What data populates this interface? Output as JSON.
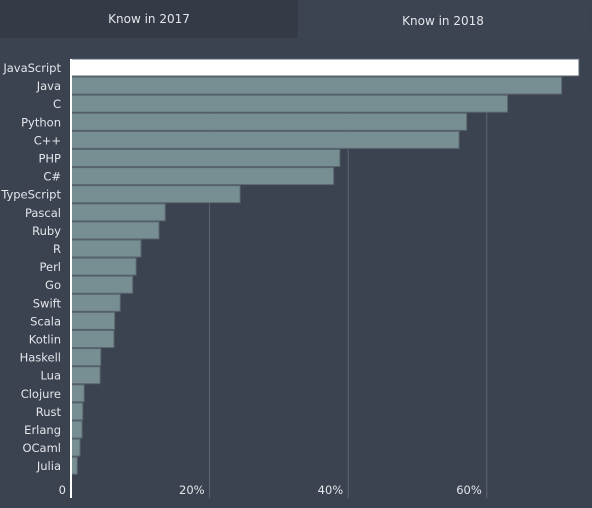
{
  "tabs": [
    {
      "label": "Know in 2017",
      "active": false
    },
    {
      "label": "Know in 2018",
      "active": true
    }
  ],
  "colors": {
    "bar": "#778f92",
    "bar_highlight": "#ffffff",
    "bar_stroke": "#5a6670",
    "gridline": "#5e6674",
    "axis": "#ffffff"
  },
  "chart_data": {
    "type": "bar",
    "orientation": "horizontal",
    "title": "",
    "xlabel": "",
    "ylabel": "",
    "xlim": [
      0,
      75
    ],
    "x_ticks": [
      0,
      20,
      40,
      60
    ],
    "x_tick_labels": [
      "0",
      "20%",
      "40%",
      "60%"
    ],
    "grid": true,
    "highlight_category": "JavaScript",
    "categories": [
      "JavaScript",
      "Java",
      "C",
      "Python",
      "C++",
      "PHP",
      "C#",
      "TypeScript",
      "Pascal",
      "Ruby",
      "R",
      "Perl",
      "Go",
      "Swift",
      "Scala",
      "Kotlin",
      "Haskell",
      "Lua",
      "Clojure",
      "Rust",
      "Erlang",
      "OCaml",
      "Julia"
    ],
    "values": [
      73.3,
      70.8,
      63.0,
      57.1,
      56.0,
      38.8,
      37.9,
      24.4,
      13.6,
      12.7,
      10.1,
      9.4,
      8.9,
      7.1,
      6.3,
      6.2,
      4.3,
      4.2,
      1.9,
      1.7,
      1.6,
      1.3,
      0.9
    ]
  }
}
